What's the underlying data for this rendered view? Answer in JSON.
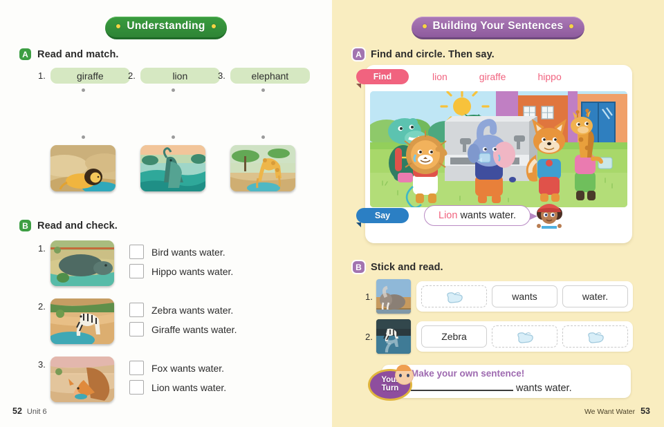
{
  "left_page": {
    "banner": "Understanding",
    "section_a": {
      "letter": "A",
      "title": "Read and match.",
      "items": [
        {
          "num": "1.",
          "word": "giraffe"
        },
        {
          "num": "2.",
          "word": "lion"
        },
        {
          "num": "3.",
          "word": "elephant"
        }
      ],
      "pictures": [
        {
          "alt": "lion lying by water"
        },
        {
          "alt": "elephant spraying water"
        },
        {
          "alt": "giraffe drinking at waterhole"
        }
      ]
    },
    "section_b": {
      "letter": "B",
      "title": "Read and check.",
      "items": [
        {
          "num": "1.",
          "photo": "hippo in water",
          "options": [
            "Bird wants water.",
            "Hippo wants water."
          ]
        },
        {
          "num": "2.",
          "photo": "zebra drinking",
          "options": [
            "Zebra wants water.",
            "Giraffe wants water."
          ]
        },
        {
          "num": "3.",
          "photo": "fox drinking",
          "options": [
            "Fox wants water.",
            "Lion wants water."
          ]
        }
      ]
    },
    "footer": {
      "page": "52",
      "unit": "Unit 6"
    }
  },
  "right_page": {
    "banner": "Building Your Sentences",
    "section_a": {
      "letter": "A",
      "title": "Find and circle. Then say.",
      "find_tag": "Find",
      "find_words": [
        "lion",
        "giraffe",
        "hippo"
      ],
      "say_tag": "Say",
      "say_highlight": "Lion",
      "say_rest": "wants water.",
      "scene_alt": "animals at a schoolyard drinking fountain"
    },
    "section_b": {
      "letter": "B",
      "title": "Stick and read.",
      "rows": [
        {
          "num": "1.",
          "photo": "elephant spraying water",
          "slots": [
            {
              "type": "sticker",
              "text": ""
            },
            {
              "type": "word",
              "text": "wants"
            },
            {
              "type": "word",
              "text": "water."
            }
          ]
        },
        {
          "num": "2.",
          "photo": "zebra at waterhole",
          "slots": [
            {
              "type": "word",
              "text": "Zebra"
            },
            {
              "type": "sticker",
              "text": ""
            },
            {
              "type": "sticker",
              "text": ""
            }
          ]
        }
      ]
    },
    "your_turn": {
      "badge_line1": "Your",
      "badge_line2": "Turn",
      "title": "Make your own sentence!",
      "blank": "",
      "tail": "wants water."
    },
    "footer": {
      "title": "We Want Water",
      "page": "53"
    }
  },
  "colors": {
    "green_banner": "#2e8435",
    "purple_banner": "#8e5a9d",
    "pink_accent": "#f1637f",
    "blue_tag": "#2b7fc4",
    "word_box": "#d6e8c2",
    "right_bg": "#f9edc0",
    "your_turn_purple": "#8e4e9e"
  }
}
